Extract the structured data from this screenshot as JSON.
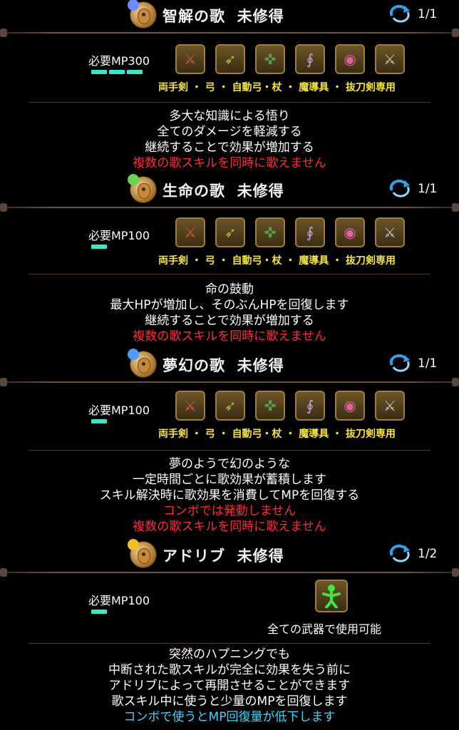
{
  "skills": [
    {
      "title": "智解の歌",
      "status": "未修得",
      "level": "1/1",
      "mp": "必要MP300",
      "mp_bars": 3,
      "note_color": "#6a8cff",
      "weapons": [
        "両手剣",
        "弓",
        "自動弓・杖",
        "魔導具",
        "抜刀剣専用"
      ],
      "weapon_line": "両手剣 ・ 弓 ・ 自動弓・杖 ・ 魔導具 ・ 抜刀剣専用",
      "desc": [
        "多大な知識による悟り",
        "全てのダメージを軽減する",
        "継続することで効果が増加する"
      ],
      "warnings": [
        "複数の歌スキルを同時に歌えません"
      ]
    },
    {
      "title": "生命の歌",
      "status": "未修得",
      "level": "1/1",
      "mp": "必要MP100",
      "mp_bars": 1,
      "note_color": "#6ad050",
      "weapon_line": "両手剣 ・ 弓 ・ 自動弓・杖 ・ 魔導具 ・ 抜刀剣専用",
      "desc": [
        "命の鼓動",
        "最大HPが増加し、そのぶんHPを回復します",
        "継続することで効果が増加する"
      ],
      "warnings": [
        "複数の歌スキルを同時に歌えません"
      ]
    },
    {
      "title": "夢幻の歌",
      "status": "未修得",
      "level": "1/1",
      "mp": "必要MP100",
      "mp_bars": 1,
      "note_color": "#4a9cff",
      "weapon_line": "両手剣 ・ 弓 ・ 自動弓・杖 ・ 魔導具 ・ 抜刀剣専用",
      "desc": [
        "夢のようで幻のような",
        "一定時間ごとに歌効果が蓄積します",
        "スキル解決時に歌効果を消費してMPを回復する"
      ],
      "warnings": [
        "コンボでは発動しません",
        "複数の歌スキルを同時に歌えません"
      ]
    },
    {
      "title": "アドリブ",
      "status": "未修得",
      "level": "1/2",
      "mp": "必要MP100",
      "mp_bars": 1,
      "note_color": "#f0c020",
      "any_weapon": "全ての武器で使用可能",
      "desc": [
        "突然のハプニングでも",
        "中断された歌スキルが完全に効果を失う前に",
        "アドリブによって再開させることができます",
        "歌スキル中に使うと少量のMPを回復します"
      ],
      "info": [
        "コンボで使うとMP回復量が低下します"
      ]
    }
  ],
  "colors": {
    "weapon_text": "#f5e53a",
    "warning": "#ff2a3a",
    "info": "#38d8ff",
    "mp_bar": "#34e8c8"
  },
  "icons": {
    "weapons": [
      "two-handed-sword-icon",
      "bow-icon",
      "crossbow-icon",
      "staff-icon",
      "magic-device-icon",
      "katana-icon"
    ],
    "any": "stick-figure-icon",
    "level": "cycle-arrow-icon"
  }
}
